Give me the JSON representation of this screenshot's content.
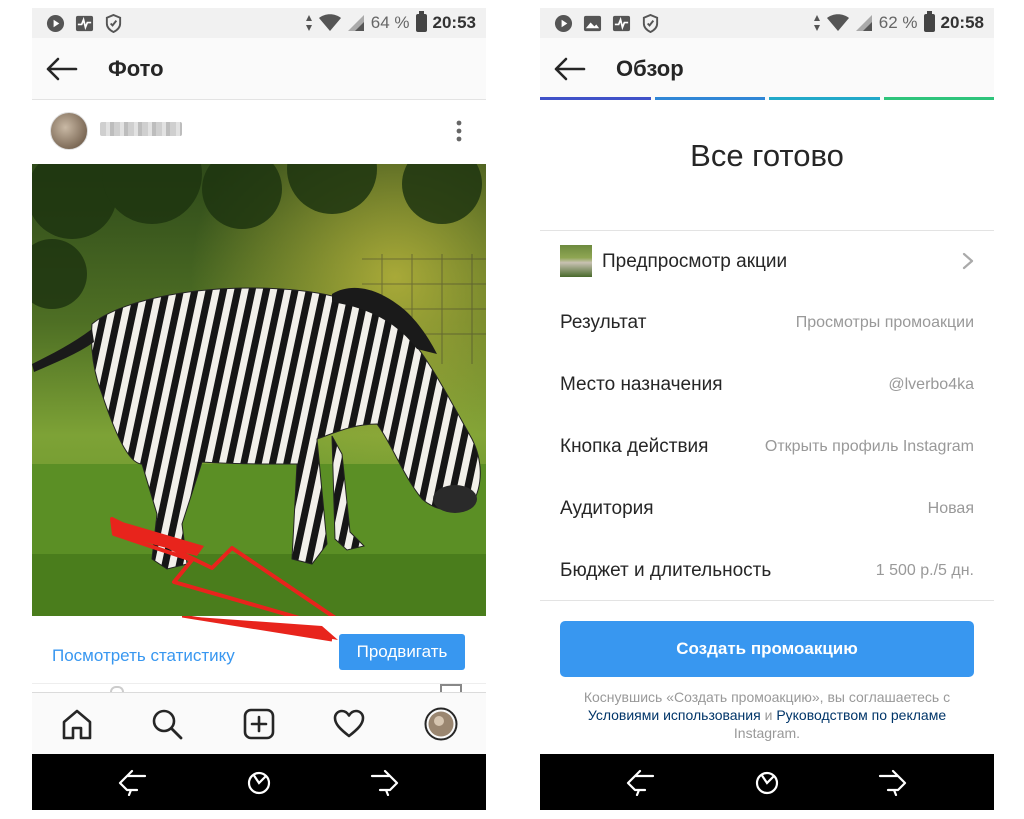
{
  "left_screen": {
    "status_bar": {
      "battery": "64 %",
      "time": "20:53"
    },
    "app_bar": {
      "title": "Фото"
    },
    "post": {
      "actions": {
        "stats_link": "Посмотреть статистику",
        "promote_button": "Продвигать"
      },
      "annotation_arrow_color": "#e8241c"
    },
    "tab_bar": {
      "icons": [
        "home-icon",
        "search-icon",
        "add-post-icon",
        "heart-icon",
        "profile-avatar"
      ]
    }
  },
  "right_screen": {
    "status_bar": {
      "battery": "62 %",
      "time": "20:58"
    },
    "app_bar": {
      "title": "Обзор"
    },
    "progress_colors": [
      "#3f51c8",
      "#2f86d6",
      "#21a9c9",
      "#2ec47b"
    ],
    "headline": "Все готово",
    "preview": {
      "label": "Предпросмотр акции"
    },
    "details": [
      {
        "key": "Результат",
        "value": "Просмотры промоакции"
      },
      {
        "key": "Место назначения",
        "value": "@lverbo4ka"
      },
      {
        "key": "Кнопка действия",
        "value": "Открыть профиль Instagram"
      },
      {
        "key": "Аудитория",
        "value": "Новая"
      },
      {
        "key": "Бюджет и длительность",
        "value": "1 500 р./5 дн."
      }
    ],
    "create_button": "Создать промоакцию",
    "legal": {
      "part1": "Коснувшись «Создать промоакцию», вы соглашаетесь с",
      "terms_link": "Условиями использования",
      "part2": "и",
      "ad_guide_link": "Руководством по рекламе",
      "part3": "Instagram."
    }
  },
  "colors": {
    "accent_blue": "#3897f0",
    "link_dark": "#003569",
    "muted_text": "#999999"
  }
}
